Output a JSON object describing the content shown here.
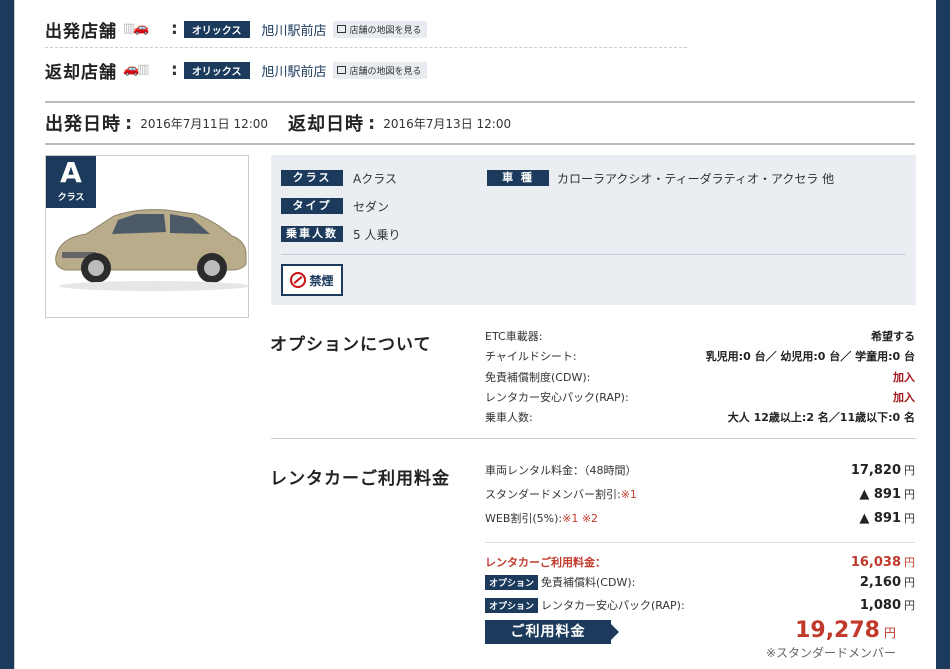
{
  "departure_store": {
    "label": "出発店舗",
    "brand": "オリックス",
    "store": "旭川駅前店",
    "map_button": "店舗の地図を見る"
  },
  "return_store": {
    "label": "返却店舗",
    "brand": "オリックス",
    "store": "旭川駅前店",
    "map_button": "店舗の地図を見る"
  },
  "dates": {
    "departure_label": "出発日時",
    "departure_value": "2016年7月11日 12:00",
    "return_label": "返却日時",
    "return_value": "2016年7月13日 12:00"
  },
  "car": {
    "class_letter": "A",
    "class_caption": "クラス",
    "specs": {
      "class_label": "クラス",
      "class_value": "Aクラス",
      "type_label": "タイプ",
      "type_value": "セダン",
      "capacity_label": "乗車人数",
      "capacity_value": "5 人乗り",
      "model_label": "車 種",
      "model_value": "カローラアクシオ・ティーダラティオ・アクセラ 他"
    },
    "nonsmoking": "禁煙"
  },
  "options": {
    "title": "オプションについて",
    "rows": [
      {
        "label": "ETC車載器:",
        "value": "希望する"
      },
      {
        "label": "チャイルドシート:",
        "value": "乳児用:0 台／ 幼児用:0 台／ 学童用:0 台"
      },
      {
        "label": "免責補償制度(CDW):",
        "value": "加入"
      },
      {
        "label": "レンタカー安心パック(RAP):",
        "value": "加入"
      },
      {
        "label": "乗車人数:",
        "value": "大人 12歳以上:2 名／11歳以下:0 名"
      }
    ]
  },
  "fees": {
    "title": "レンタカーご利用料金",
    "rows": [
      {
        "label": "車両レンタル料金：（48時間）",
        "amount": "17,820"
      },
      {
        "label": "スタンダードメンバー割引:",
        "note": "※1",
        "amount": "▲ 891"
      },
      {
        "label": "WEB割引(5%):",
        "note": "※1 ※2",
        "amount": "▲ 891"
      }
    ],
    "subtotal_label": "レンタカーご利用料金：",
    "subtotal_amount": "16,038",
    "option_tag": "オプション",
    "option_rows": [
      {
        "label": "免責補償料(CDW):",
        "amount": "2,160"
      },
      {
        "label": "レンタカー安心パック(RAP):",
        "amount": "1,080"
      }
    ],
    "yen": "円",
    "total_button": "ご利用料金",
    "total_amount": "19,278",
    "member_note": "※スタンダードメンバー"
  }
}
